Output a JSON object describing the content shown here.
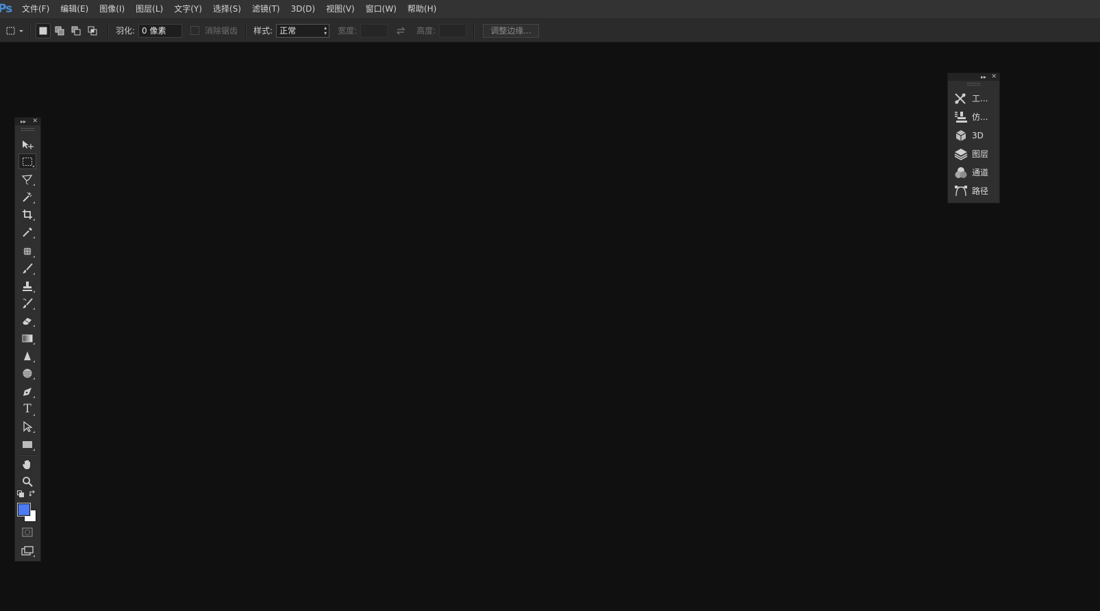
{
  "app": {
    "logo": "Ps"
  },
  "menu": [
    {
      "label": "文件(F)"
    },
    {
      "label": "编辑(E)"
    },
    {
      "label": "图像(I)"
    },
    {
      "label": "图层(L)"
    },
    {
      "label": "文字(Y)"
    },
    {
      "label": "选择(S)"
    },
    {
      "label": "滤镜(T)"
    },
    {
      "label": "3D(D)"
    },
    {
      "label": "视图(V)"
    },
    {
      "label": "窗口(W)"
    },
    {
      "label": "帮助(H)"
    }
  ],
  "options": {
    "feather_label": "羽化:",
    "feather_value": "0 像素",
    "antialias_label": "消除锯齿",
    "style_label": "样式:",
    "style_value": "正常",
    "width_label": "宽度:",
    "width_value": "",
    "height_label": "高度:",
    "height_value": "",
    "refine_edge_label": "调整边缘..."
  },
  "tools": [
    {
      "name": "move-tool-icon"
    },
    {
      "name": "rect-marquee-tool-icon"
    },
    {
      "name": "lasso-tool-icon"
    },
    {
      "name": "magic-wand-tool-icon"
    },
    {
      "name": "crop-tool-icon"
    },
    {
      "name": "eyedropper-tool-icon"
    },
    {
      "name": "healing-brush-tool-icon"
    },
    {
      "name": "brush-tool-icon"
    },
    {
      "name": "clone-stamp-tool-icon"
    },
    {
      "name": "history-brush-tool-icon"
    },
    {
      "name": "eraser-tool-icon"
    },
    {
      "name": "gradient-tool-icon"
    },
    {
      "name": "blur-tool-icon"
    },
    {
      "name": "dodge-tool-icon"
    },
    {
      "name": "pen-tool-icon"
    },
    {
      "name": "type-tool-icon"
    },
    {
      "name": "path-selection-tool-icon"
    },
    {
      "name": "rectangle-tool-icon"
    },
    {
      "name": "hand-tool-icon"
    },
    {
      "name": "zoom-tool-icon"
    }
  ],
  "colors": {
    "foreground": "#4d7cf2",
    "background": "#ffffff",
    "ui_bg": "#101010",
    "panel": "#2f2f2f"
  },
  "dock": [
    {
      "icon": "tool-presets-icon",
      "label": "工..."
    },
    {
      "icon": "clone-source-icon",
      "label": "仿..."
    },
    {
      "icon": "3d-icon",
      "label": "3D"
    },
    {
      "icon": "layers-icon",
      "label": "图层"
    },
    {
      "icon": "channels-icon",
      "label": "通道"
    },
    {
      "icon": "paths-icon",
      "label": "路径"
    }
  ],
  "type_tool_glyph": "T"
}
